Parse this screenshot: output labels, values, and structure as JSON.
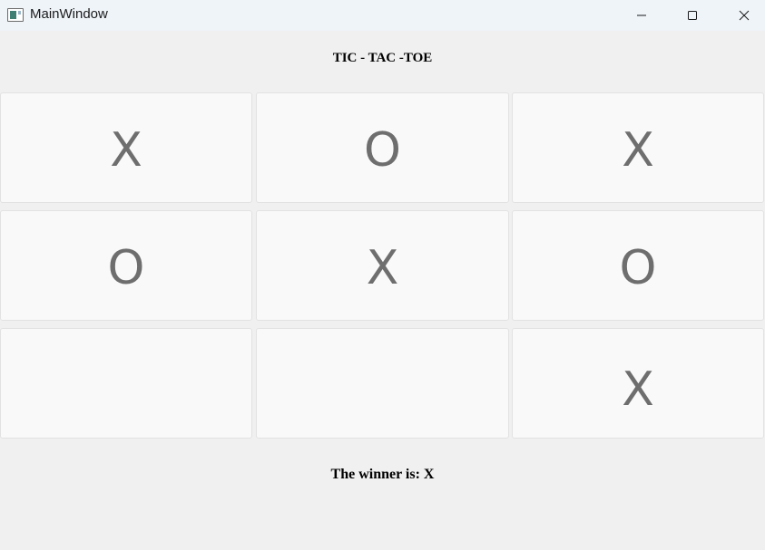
{
  "window": {
    "title": "MainWindow",
    "icons": {
      "app": "app-window-icon",
      "minimize": "minimize-icon",
      "maximize": "maximize-icon",
      "close": "close-icon"
    }
  },
  "game": {
    "heading": "TIC - TAC -TOE",
    "board": [
      [
        "X",
        "O",
        "X"
      ],
      [
        "O",
        "X",
        "O"
      ],
      [
        "",
        "",
        "X"
      ]
    ],
    "status": "The winner is: X"
  },
  "colors": {
    "background": "#f0f0f0",
    "titlebar": "#eff4f9",
    "cell_bg": "#f9f9f9",
    "cell_border": "#e2e2e2",
    "mark": "#6e6e6e"
  }
}
